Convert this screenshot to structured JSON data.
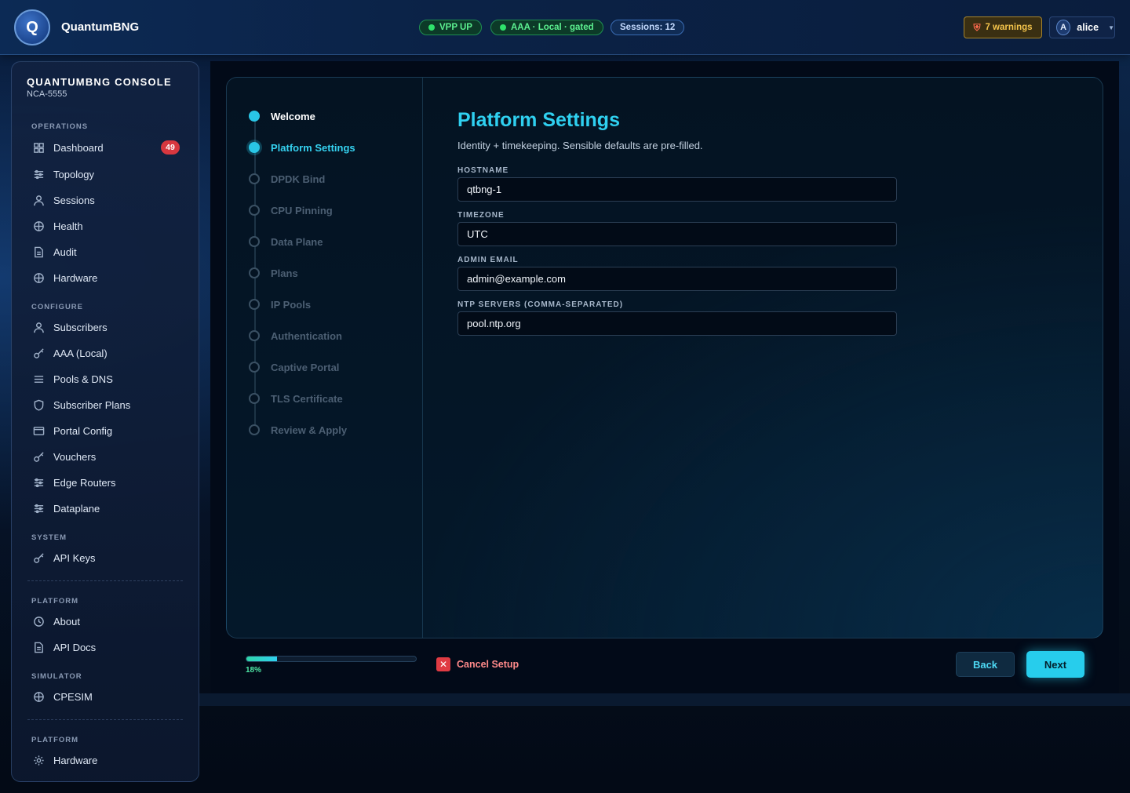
{
  "header": {
    "logo_letter": "Q",
    "brand": "QuantumBNG",
    "pills": [
      "VPP UP",
      "AAA · Local · gated",
      "Sessions: 12"
    ],
    "warnings": "7 warnings",
    "user": {
      "initial": "A",
      "name": "alice"
    }
  },
  "sidebar": {
    "title": "QUANTUMBNG CONSOLE",
    "subtitle": "NCA-5555",
    "sections": {
      "operations": "OPERATIONS",
      "configure": "CONFIGURE",
      "system": "SYSTEM",
      "platform": "PLATFORM",
      "simulator": "SIMULATOR",
      "platform2": "PLATFORM"
    },
    "items": {
      "dashboard": "Dashboard",
      "dashboard_badge": "49",
      "topology": "Topology",
      "sessions": "Sessions",
      "health": "Health",
      "audit": "Audit",
      "hardware": "Hardware",
      "subscribers": "Subscribers",
      "aaa": "AAA (Local)",
      "pools": "Pools & DNS",
      "plans": "Subscriber Plans",
      "portal": "Portal Config",
      "vouchers": "Vouchers",
      "edge_routers": "Edge Routers",
      "dataplane": "Dataplane",
      "api_keys": "API Keys",
      "about": "About",
      "api_docs": "API Docs",
      "cpesim": "CPESIM",
      "hardware2": "Hardware"
    }
  },
  "wizard": {
    "steps": [
      "Welcome",
      "Platform Settings",
      "DPDK Bind",
      "CPU Pinning",
      "Data Plane",
      "Plans",
      "IP Pools",
      "Authentication",
      "Captive Portal",
      "TLS Certificate",
      "Review & Apply"
    ],
    "title": "Platform Settings",
    "subtitle": "Identity + timekeeping. Sensible defaults are pre-filled.",
    "fields": {
      "hostname_label": "HOSTNAME",
      "hostname_value": "qtbng-1",
      "timezone_label": "TIMEZONE",
      "timezone_value": "UTC",
      "email_label": "ADMIN EMAIL",
      "email_value": "admin@example.com",
      "ntp_label": "NTP SERVERS (COMMA-SEPARATED)",
      "ntp_value": "pool.ntp.org"
    },
    "progress": 0.18,
    "progress_text": "18%",
    "cancel": "Cancel Setup",
    "back": "Back",
    "next": "Next"
  }
}
